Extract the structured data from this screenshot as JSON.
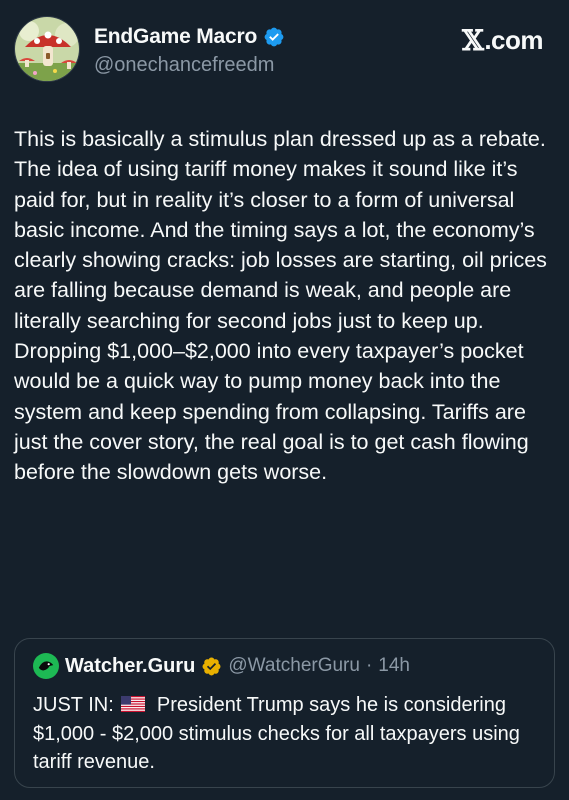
{
  "author": {
    "display_name": "EndGame Macro",
    "handle": "@onechancefreedm",
    "verified": true,
    "verified_color": "#1d9bf0"
  },
  "brand": {
    "logo_letter": "𝕏",
    "logo_suffix": ".com"
  },
  "tweet": {
    "text": "This is basically a stimulus plan dressed up as a rebate. The idea of using tariff money makes it sound like it’s paid for, but in reality it’s closer to a form of universal basic income. And the timing says a lot, the economy’s clearly showing cracks: job losses are starting, oil prices are falling because demand is weak, and people are literally searching for second jobs just to keep up. Dropping $1,000–$2,000 into every taxpayer’s pocket would be a quick way to pump money back into the system and keep spending from collapsing. Tariffs are just the cover story, the real goal is to get cash flowing before the slowdown gets worse."
  },
  "quoted_tweet": {
    "display_name": "Watcher.Guru",
    "handle": "@WatcherGuru",
    "separator": "·",
    "time": "14h",
    "verified_badge": "gold",
    "verified_color": "#e8b000",
    "text_prefix": "JUST IN:",
    "flag_icon": "us-flag-icon",
    "text_body": "President Trump says he is considering $1,000 - $2,000 stimulus checks for all taxpayers using tariff revenue."
  },
  "colors": {
    "background": "#15202b",
    "text_primary": "#f7f9f9",
    "text_secondary": "#8b98a5",
    "border": "#38444d"
  }
}
